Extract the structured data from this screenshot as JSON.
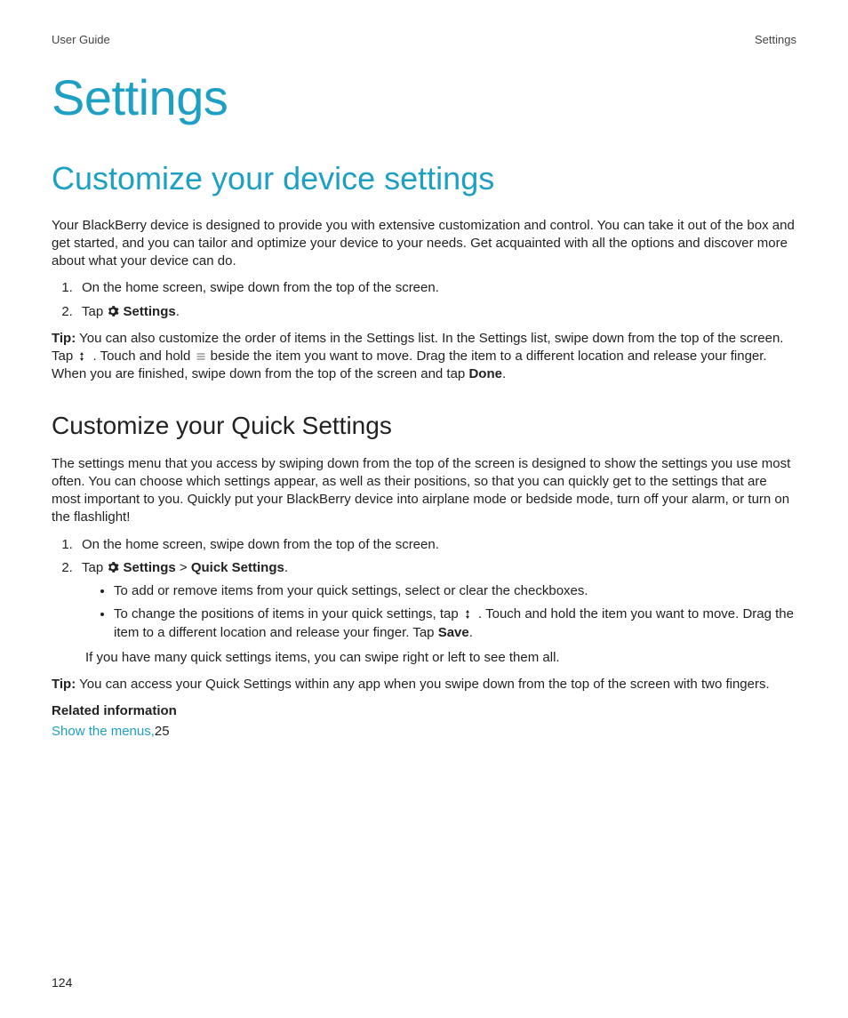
{
  "header": {
    "left": "User Guide",
    "right": "Settings"
  },
  "title": "Settings",
  "h2_customize": "Customize your device settings",
  "intro": "Your BlackBerry device is designed to provide you with extensive customization and control. You can take it out of the box and get started, and you can tailor and optimize your device to your needs. Get acquainted with all the options and discover more about what your device can do.",
  "steps1": {
    "s1": "On the home screen, swipe down from the top of the screen.",
    "s2_pre": "Tap ",
    "s2_settings": "Settings",
    "s2_post": "."
  },
  "tip1": {
    "label": "Tip:",
    "a": " You can also customize the order of items in the Settings list. In the Settings list, swipe down from the top of the screen. Tap ",
    "b": " . Touch and hold ",
    "c": " beside the item you want to move. Drag the item to a different location and release your finger. When you are finished, swipe down from the top of the screen and tap ",
    "done": "Done",
    "d": "."
  },
  "h3_quick": "Customize your Quick Settings",
  "quick_intro": "The settings menu that you access by swiping down from the top of the screen is designed to show the settings you use most often. You can choose which settings appear, as well as their positions, so that you can quickly get to the settings that are most important to you. Quickly put your BlackBerry device into airplane mode or bedside mode, turn off your alarm, or turn on the flashlight!",
  "steps2": {
    "s1": "On the home screen, swipe down from the top of the screen.",
    "s2_pre": "Tap ",
    "s2_settings": "Settings",
    "s2_sep": " > ",
    "s2_quick": "Quick Settings",
    "s2_post": ".",
    "b1": "To add or remove items from your quick settings, select or clear the checkboxes.",
    "b2_a": "To change the positions of items in your quick settings, tap ",
    "b2_b": " . Touch and hold the item you want to move. Drag the item to a different location and release your finger. Tap ",
    "b2_save": "Save",
    "b2_c": ".",
    "after": "If you have many quick settings items, you can swipe right or left to see them all."
  },
  "tip2": {
    "label": "Tip:",
    "text": " You can access your Quick Settings within any app when you swipe down from the top of the screen with two fingers."
  },
  "related": {
    "heading": "Related information",
    "link": "Show the menus,",
    "page": "25"
  },
  "page_number": "124"
}
